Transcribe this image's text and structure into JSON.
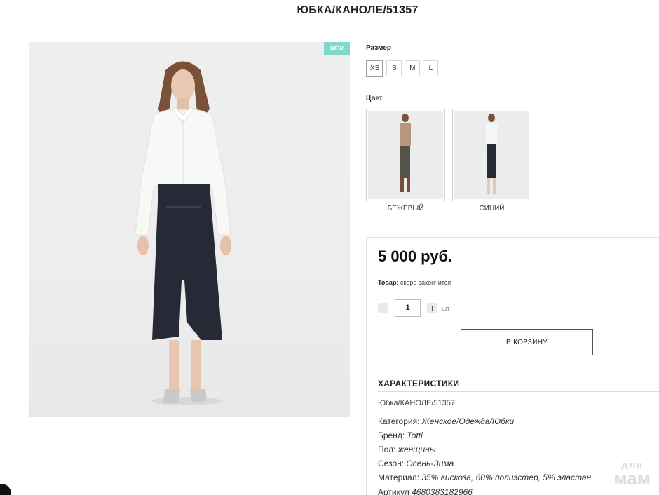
{
  "product": {
    "title": "ЮБКА/КАНОЛЕ/51357",
    "badge": "NEW"
  },
  "size": {
    "label": "Размер",
    "options": [
      "XS",
      "S",
      "M",
      "L"
    ],
    "selected": "XS"
  },
  "color": {
    "label": "Цвет",
    "options": [
      {
        "name": "БЕЖЕВЫЙ"
      },
      {
        "name": "СИНИЙ"
      }
    ]
  },
  "buy": {
    "price": "5 000 руб.",
    "stock_label": "Товар:",
    "stock_value": "скоро закончится",
    "qty_minus": "−",
    "qty_value": "1",
    "qty_plus": "+",
    "qty_unit": "шт",
    "cart_button": "В КОРЗИНУ"
  },
  "specs": {
    "title": "ХАРАКТЕРИСТИКИ",
    "sku_line": "Юбка/КАНОЛЕ/51357",
    "rows": [
      {
        "label": "Категория:",
        "value": "Женское/Одежда/Юбки"
      },
      {
        "label": "Бренд:",
        "value": "Totti"
      },
      {
        "label": "Пол:",
        "value": "женщины"
      },
      {
        "label": "Сезон:",
        "value": "Осень-Зима"
      },
      {
        "label": "Материал:",
        "value": "35% вискоза, 60% полиэстер, 5% эластан"
      },
      {
        "label": "Артикул",
        "value": "4680383182966"
      }
    ]
  },
  "watermark": {
    "line1": "для",
    "line2": "мам"
  },
  "colors": {
    "badge": "#7fd8c9",
    "skirt_navy": "#252a36",
    "skirt_olive": "#55524a"
  }
}
